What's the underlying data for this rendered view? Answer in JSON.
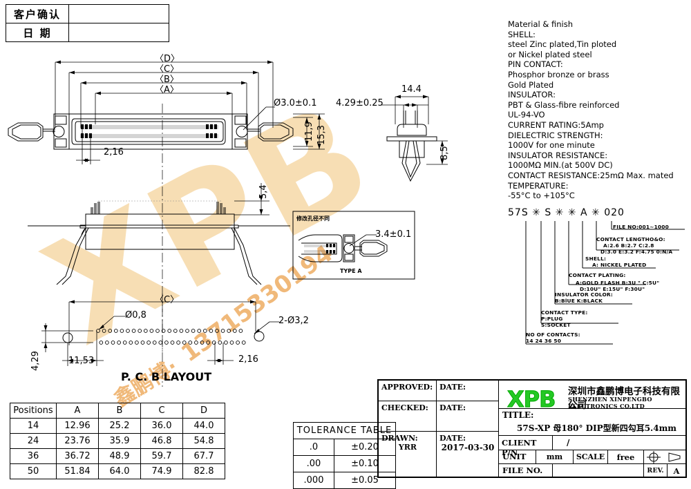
{
  "confirm_table": {
    "rows": [
      {
        "label": "客户确认",
        "value": ""
      },
      {
        "label": "日   期",
        "value": ""
      }
    ]
  },
  "spec_text": {
    "lines": [
      "Material & finish",
      "SHELL:",
      "steel Zinc plated,Tin ploted",
      "or Nickel plated steel",
      "PIN CONTACT:",
      "Phosphor bronze or brass",
      "Gold Plated",
      "INSULATOR:",
      "PBT & Glass-fibre reinforced",
      "UL-94-VO",
      "CURRENT RATING:5Amp",
      "DIELECTRIC STRENGTH:",
      "1000V for one minute",
      "INSULATOR RESISTANCE:",
      "1000MΩ MIN.(at 500V DC)",
      "CONTACT RESISTANCE:25mΩ Max. mated",
      "TEMPERATURE:",
      "-55°C to +105°C"
    ]
  },
  "part_number": {
    "code": "57S ✳  S ✳  ✳  A ✳   020",
    "callouts": [
      {
        "title": "FILE NO:001~1000",
        "lines": []
      },
      {
        "title": "CONTACT LENGTHO&O:",
        "lines": [
          "A:2.6      B:2.7      C:2.8",
          "D:3.0      E:3.2      F:4.75      0:N/A"
        ]
      },
      {
        "title": "SHELL:",
        "lines": [
          "A: NICKEL PLATED"
        ]
      },
      {
        "title": "CONTACT PLATING:",
        "lines": [
          "A:GOLD FLASH    B:3U \" C:5U\"",
          "D:10U\"  E:15U\"  F:30U\""
        ]
      },
      {
        "title": "INSULATOR COLOR:",
        "lines": [
          "B:BlUE  K:BLACK"
        ]
      },
      {
        "title": "CONTACT TYPE:",
        "lines": [
          "P:PLUG",
          "S:SOCKET"
        ]
      },
      {
        "title": "NO  OF CONTACTS:",
        "lines": [
          "14  24  36  50"
        ]
      }
    ]
  },
  "dimensions": {
    "D": "〈D〉",
    "C": "〈C〉",
    "B": "〈B〉",
    "A": "〈A〉",
    "hole_3_0": "Ø3.0±0.1",
    "pitch_2_16": "2,16",
    "h_11_9": "11,9",
    "h_15_3": "15,3",
    "w_14_4": "14.4",
    "d_4_29_025": "4.29±0.25",
    "h_8_5": "8,5",
    "h_5_4": "5,4",
    "detail_3_4": "3.4±0.1",
    "detail_label": "TYPE A",
    "detail_note": "修改孔径不同",
    "pcb_C": "〈C〉",
    "pcb_hole_08": "Ø0,8",
    "pcb_2_hole": "2-Ø3,2",
    "pcb_11_53": "11,53",
    "pcb_4_29": "4,29",
    "pcb_2_16": "2,16",
    "pcb_title": "P. C. B  LAYOUT"
  },
  "positions_table": {
    "headers": [
      "Positions",
      "A",
      "B",
      "C",
      "D"
    ],
    "rows": [
      [
        "14",
        "12.96",
        "25.2",
        "36.0",
        "44.0"
      ],
      [
        "24",
        "23.76",
        "35.9",
        "46.8",
        "54.8"
      ],
      [
        "36",
        "36.72",
        "48.9",
        "59.7",
        "67.7"
      ],
      [
        "50",
        "51.84",
        "64.0",
        "74.9",
        "82.8"
      ]
    ]
  },
  "tolerance_table": {
    "title": "TOLERANCE  TABLE",
    "rows": [
      [
        ".0",
        "±0.20"
      ],
      [
        ".00",
        "±0.10"
      ],
      [
        ".000",
        "±0.05"
      ]
    ]
  },
  "title_block": {
    "approved_label": "APPROVED:",
    "approved_value": "",
    "approved_date_label": "DATE:",
    "approved_date_value": "",
    "checked_label": "CHECKED:",
    "checked_value": "",
    "checked_date_label": "DATE:",
    "checked_date_value": "",
    "drawn_label": "DRAWN:",
    "drawn_value": "YRR",
    "drawn_date_label": "DATE:",
    "drawn_date_value": "2017-03-30",
    "logo_text": "XPB",
    "company_cn": "深圳市鑫鹏博电子科技有限公司",
    "company_en": "SHENZHEN XINPENGBO ELECTRONICS CO.LTD",
    "title_label": "TITLE:",
    "title_value": "57S-XP 母180° DIP型新四勾耳5.4mm",
    "client_pn_label": "CLIENT P/N",
    "client_pn_value": "/",
    "unit_label": "UNIT",
    "unit_value": "mm",
    "scale_label": "SCALE",
    "scale_value": "free",
    "file_no_label": "FILE NO.",
    "file_no_value": "",
    "rev_label": "REV.",
    "rev_value": "A"
  },
  "watermark": {
    "logo": "XPB",
    "phone": "13715330194",
    "cn": "鑫鹏博·"
  },
  "colors": {
    "brand_green": "#25c825",
    "watermark": "#f0b97a",
    "line": "#000000"
  }
}
